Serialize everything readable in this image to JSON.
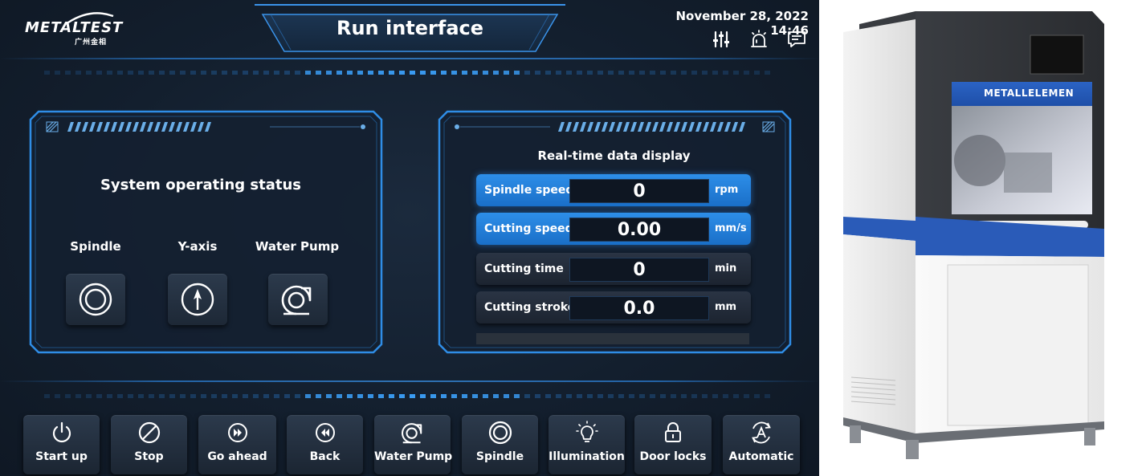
{
  "header": {
    "logo_text": "METALTEST",
    "logo_subtext": "广州金相",
    "title": "Run interface",
    "datetime": "November 28, 2022 14:46",
    "icons": [
      "sliders-icon",
      "alarm-icon",
      "message-icon"
    ]
  },
  "status_panel": {
    "title": "System operating status",
    "items": [
      {
        "label": "Spindle",
        "icon": "spindle-icon"
      },
      {
        "label": "Y-axis",
        "icon": "y-axis-icon"
      },
      {
        "label": "Water Pump",
        "icon": "water-pump-icon"
      }
    ]
  },
  "realtime_panel": {
    "title": "Real-time data display",
    "rows": [
      {
        "label": "Spindle speed",
        "value": "0",
        "unit": "rpm",
        "active": true
      },
      {
        "label": "Cutting speed",
        "value": "0.00",
        "unit": "mm/s",
        "active": true
      },
      {
        "label": "Cutting time",
        "value": "0",
        "unit": "min",
        "active": false
      },
      {
        "label": "Cutting stroke",
        "value": "0.0",
        "unit": "mm",
        "active": false
      }
    ]
  },
  "bottom_bar": {
    "buttons": [
      {
        "label": "Start up",
        "icon": "power-icon"
      },
      {
        "label": "Stop",
        "icon": "stop-icon"
      },
      {
        "label": "Go ahead",
        "icon": "fast-forward-icon"
      },
      {
        "label": "Back",
        "icon": "rewind-icon"
      },
      {
        "label": "Water Pump",
        "icon": "water-pump-icon"
      },
      {
        "label": "Spindle",
        "icon": "spindle-icon"
      },
      {
        "label": "Illumination",
        "icon": "lightbulb-icon"
      },
      {
        "label": "Door locks",
        "icon": "lock-icon"
      },
      {
        "label": "Automatic",
        "icon": "auto-mode-icon"
      }
    ]
  },
  "machine": {
    "brand_label": "METALLELEMEN"
  },
  "colors": {
    "background": "#131f2e",
    "accent_blue": "#2d8ee8",
    "frame_glow": "#3a93ea",
    "button_dark": "#243142"
  }
}
